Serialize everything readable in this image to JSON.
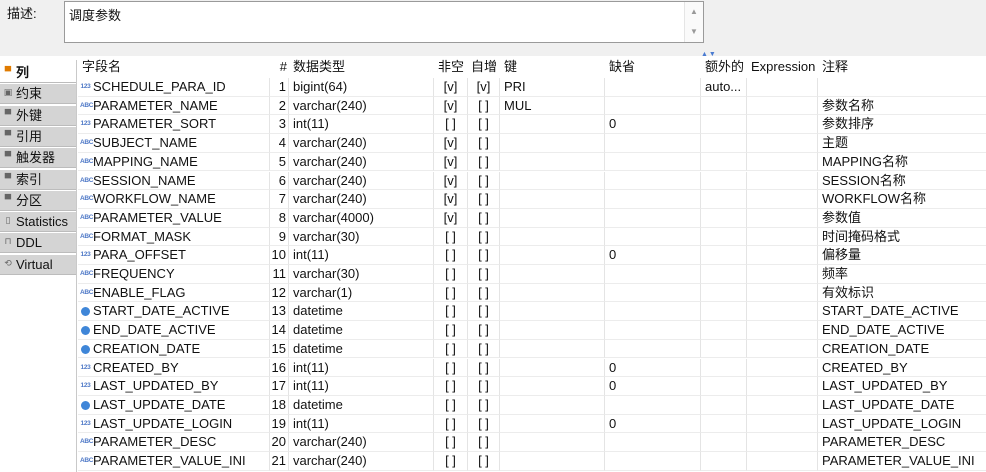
{
  "description": {
    "label": "描述:",
    "value": "调度参数"
  },
  "side_tabs": [
    {
      "label": "列",
      "icon": "columns-icon",
      "active": true
    },
    {
      "label": "约束",
      "icon": "constraint-icon",
      "active": false
    },
    {
      "label": "外键",
      "icon": "foreign-key-icon",
      "active": false
    },
    {
      "label": "引用",
      "icon": "reference-icon",
      "active": false
    },
    {
      "label": "触发器",
      "icon": "trigger-icon",
      "active": false
    },
    {
      "label": "索引",
      "icon": "index-icon",
      "active": false
    },
    {
      "label": "分区",
      "icon": "partition-icon",
      "active": false
    },
    {
      "label": "Statistics",
      "icon": "statistics-icon",
      "active": false
    },
    {
      "label": "DDL",
      "icon": "ddl-icon",
      "active": false
    },
    {
      "label": "Virtual",
      "icon": "virtual-icon",
      "active": false
    }
  ],
  "columns": {
    "name": "字段名",
    "num": "#",
    "type": "数据类型",
    "not_null": "非空",
    "auto_inc": "自增",
    "key": "键",
    "default": "缺省",
    "extra": "额外的",
    "expression": "Expression",
    "comment": "注释"
  },
  "rows": [
    {
      "icon": "123",
      "name": "SCHEDULE_PARA_ID",
      "num": "1",
      "type": "bigint(64)",
      "nn": "[v]",
      "ai": "[v]",
      "key": "PRI",
      "def": "",
      "extra": "auto...",
      "expr": "",
      "cmt": ""
    },
    {
      "icon": "abc",
      "name": "PARAMETER_NAME",
      "num": "2",
      "type": "varchar(240)",
      "nn": "[v]",
      "ai": "[ ]",
      "key": "MUL",
      "def": "",
      "extra": "",
      "expr": "",
      "cmt": "参数名称"
    },
    {
      "icon": "123",
      "name": "PARAMETER_SORT",
      "num": "3",
      "type": "int(11)",
      "nn": "[ ]",
      "ai": "[ ]",
      "key": "",
      "def": "0",
      "extra": "",
      "expr": "",
      "cmt": "参数排序"
    },
    {
      "icon": "abc",
      "name": "SUBJECT_NAME",
      "num": "4",
      "type": "varchar(240)",
      "nn": "[v]",
      "ai": "[ ]",
      "key": "",
      "def": "",
      "extra": "",
      "expr": "",
      "cmt": "主题"
    },
    {
      "icon": "abc",
      "name": "MAPPING_NAME",
      "num": "5",
      "type": "varchar(240)",
      "nn": "[v]",
      "ai": "[ ]",
      "key": "",
      "def": "",
      "extra": "",
      "expr": "",
      "cmt": "MAPPING名称"
    },
    {
      "icon": "abc",
      "name": "SESSION_NAME",
      "num": "6",
      "type": "varchar(240)",
      "nn": "[v]",
      "ai": "[ ]",
      "key": "",
      "def": "",
      "extra": "",
      "expr": "",
      "cmt": "SESSION名称"
    },
    {
      "icon": "abc",
      "name": "WORKFLOW_NAME",
      "num": "7",
      "type": "varchar(240)",
      "nn": "[v]",
      "ai": "[ ]",
      "key": "",
      "def": "",
      "extra": "",
      "expr": "",
      "cmt": "WORKFLOW名称"
    },
    {
      "icon": "abc",
      "name": "PARAMETER_VALUE",
      "num": "8",
      "type": "varchar(4000)",
      "nn": "[v]",
      "ai": "[ ]",
      "key": "",
      "def": "",
      "extra": "",
      "expr": "",
      "cmt": "参数值"
    },
    {
      "icon": "abc",
      "name": "FORMAT_MASK",
      "num": "9",
      "type": "varchar(30)",
      "nn": "[ ]",
      "ai": "[ ]",
      "key": "",
      "def": "",
      "extra": "",
      "expr": "",
      "cmt": "时间掩码格式"
    },
    {
      "icon": "123",
      "name": "PARA_OFFSET",
      "num": "10",
      "type": "int(11)",
      "nn": "[ ]",
      "ai": "[ ]",
      "key": "",
      "def": "0",
      "extra": "",
      "expr": "",
      "cmt": "偏移量"
    },
    {
      "icon": "abc",
      "name": "FREQUENCY",
      "num": "11",
      "type": "varchar(30)",
      "nn": "[ ]",
      "ai": "[ ]",
      "key": "",
      "def": "",
      "extra": "",
      "expr": "",
      "cmt": "频率"
    },
    {
      "icon": "abc",
      "name": "ENABLE_FLAG",
      "num": "12",
      "type": "varchar(1)",
      "nn": "[ ]",
      "ai": "[ ]",
      "key": "",
      "def": "",
      "extra": "",
      "expr": "",
      "cmt": "有效标识"
    },
    {
      "icon": "clock",
      "name": "START_DATE_ACTIVE",
      "num": "13",
      "type": "datetime",
      "nn": "[ ]",
      "ai": "[ ]",
      "key": "",
      "def": "",
      "extra": "",
      "expr": "",
      "cmt": "START_DATE_ACTIVE"
    },
    {
      "icon": "clock",
      "name": "END_DATE_ACTIVE",
      "num": "14",
      "type": "datetime",
      "nn": "[ ]",
      "ai": "[ ]",
      "key": "",
      "def": "",
      "extra": "",
      "expr": "",
      "cmt": "END_DATE_ACTIVE"
    },
    {
      "icon": "clock",
      "name": "CREATION_DATE",
      "num": "15",
      "type": "datetime",
      "nn": "[ ]",
      "ai": "[ ]",
      "key": "",
      "def": "",
      "extra": "",
      "expr": "",
      "cmt": "CREATION_DATE"
    },
    {
      "icon": "123",
      "name": "CREATED_BY",
      "num": "16",
      "type": "int(11)",
      "nn": "[ ]",
      "ai": "[ ]",
      "key": "",
      "def": "0",
      "extra": "",
      "expr": "",
      "cmt": "CREATED_BY"
    },
    {
      "icon": "123",
      "name": "LAST_UPDATED_BY",
      "num": "17",
      "type": "int(11)",
      "nn": "[ ]",
      "ai": "[ ]",
      "key": "",
      "def": "0",
      "extra": "",
      "expr": "",
      "cmt": "LAST_UPDATED_BY"
    },
    {
      "icon": "clock",
      "name": "LAST_UPDATE_DATE",
      "num": "18",
      "type": "datetime",
      "nn": "[ ]",
      "ai": "[ ]",
      "key": "",
      "def": "",
      "extra": "",
      "expr": "",
      "cmt": "LAST_UPDATE_DATE"
    },
    {
      "icon": "123",
      "name": "LAST_UPDATE_LOGIN",
      "num": "19",
      "type": "int(11)",
      "nn": "[ ]",
      "ai": "[ ]",
      "key": "",
      "def": "0",
      "extra": "",
      "expr": "",
      "cmt": "LAST_UPDATE_LOGIN"
    },
    {
      "icon": "abc",
      "name": "PARAMETER_DESC",
      "num": "20",
      "type": "varchar(240)",
      "nn": "[ ]",
      "ai": "[ ]",
      "key": "",
      "def": "",
      "extra": "",
      "expr": "",
      "cmt": "PARAMETER_DESC"
    },
    {
      "icon": "abc",
      "name": "PARAMETER_VALUE_INI",
      "num": "21",
      "type": "varchar(240)",
      "nn": "[ ]",
      "ai": "[ ]",
      "key": "",
      "def": "",
      "extra": "",
      "expr": "",
      "cmt": "PARAMETER_VALUE_INI"
    }
  ]
}
